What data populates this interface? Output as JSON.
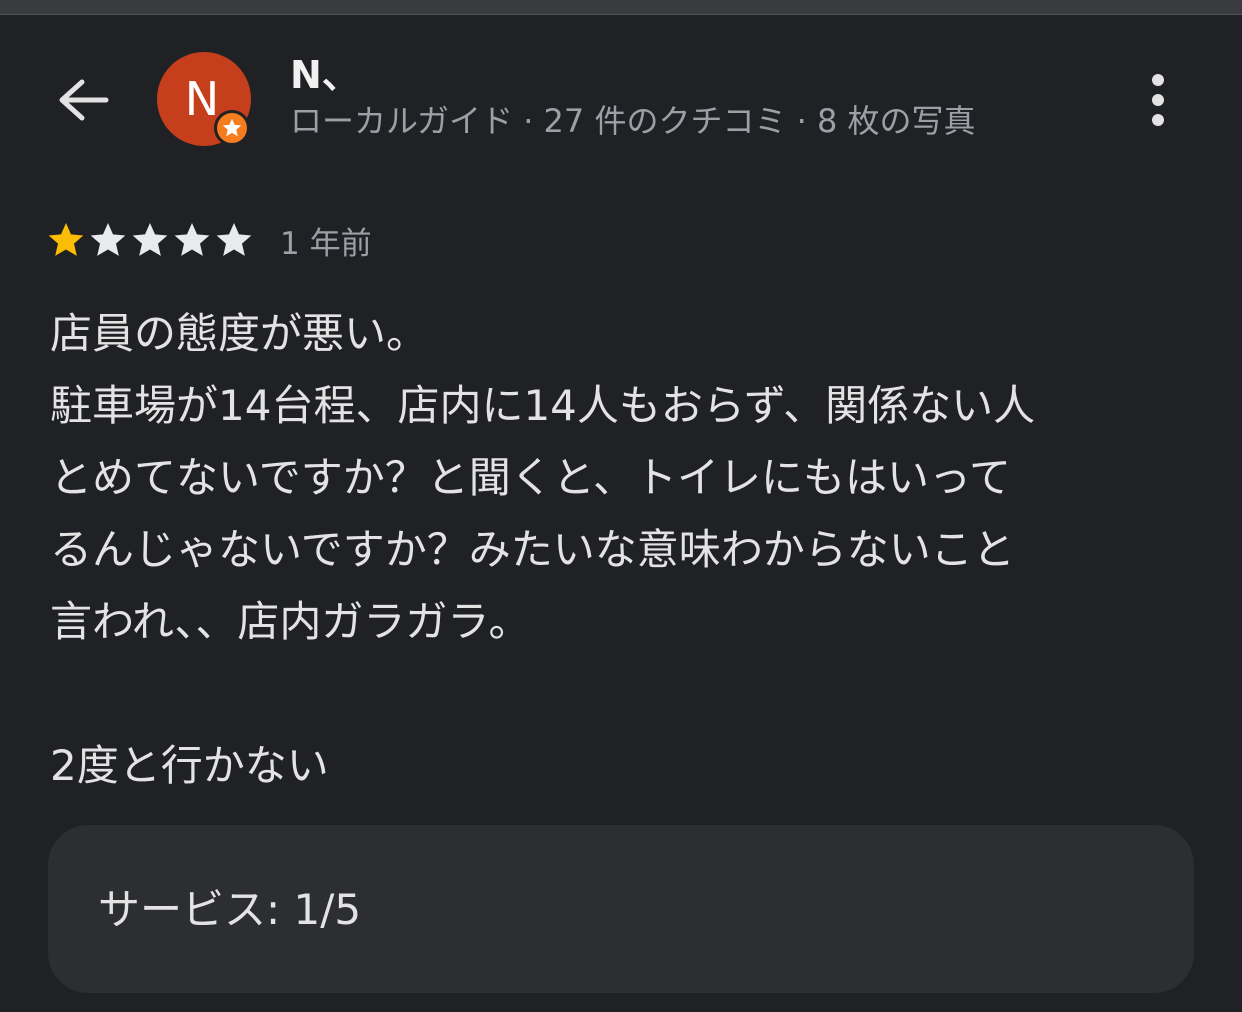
{
  "header": {
    "user_name": "N、",
    "avatar_initial": "N",
    "meta": "ローカルガイド · 27 件のクチコミ · 8 枚の写真",
    "icons": {
      "back": "arrow-back-icon",
      "more": "more-vert-icon",
      "badge": "local-guide-star-icon"
    }
  },
  "review": {
    "rating": 1,
    "rating_max": 5,
    "date": "1 年前",
    "lines": [
      "店員の態度が悪い。",
      "駐車場が14台程、店内に14人もおらず、関係ない人",
      "とめてないですか？と聞くと、トイレにもはいって",
      "るんじゃないですか？みたいな意味わからないこと",
      "言われ、、店内ガラガラ。",
      "",
      "2度と行かない"
    ]
  },
  "aspect": {
    "text": "サービス: 1/5"
  },
  "colors": {
    "background": "#202124",
    "avatar": "#c53f1d",
    "badge": "#f57c1f",
    "star_filled": "#fbbc04",
    "star_empty": "#e8eaed",
    "card": "#2d2e31"
  }
}
